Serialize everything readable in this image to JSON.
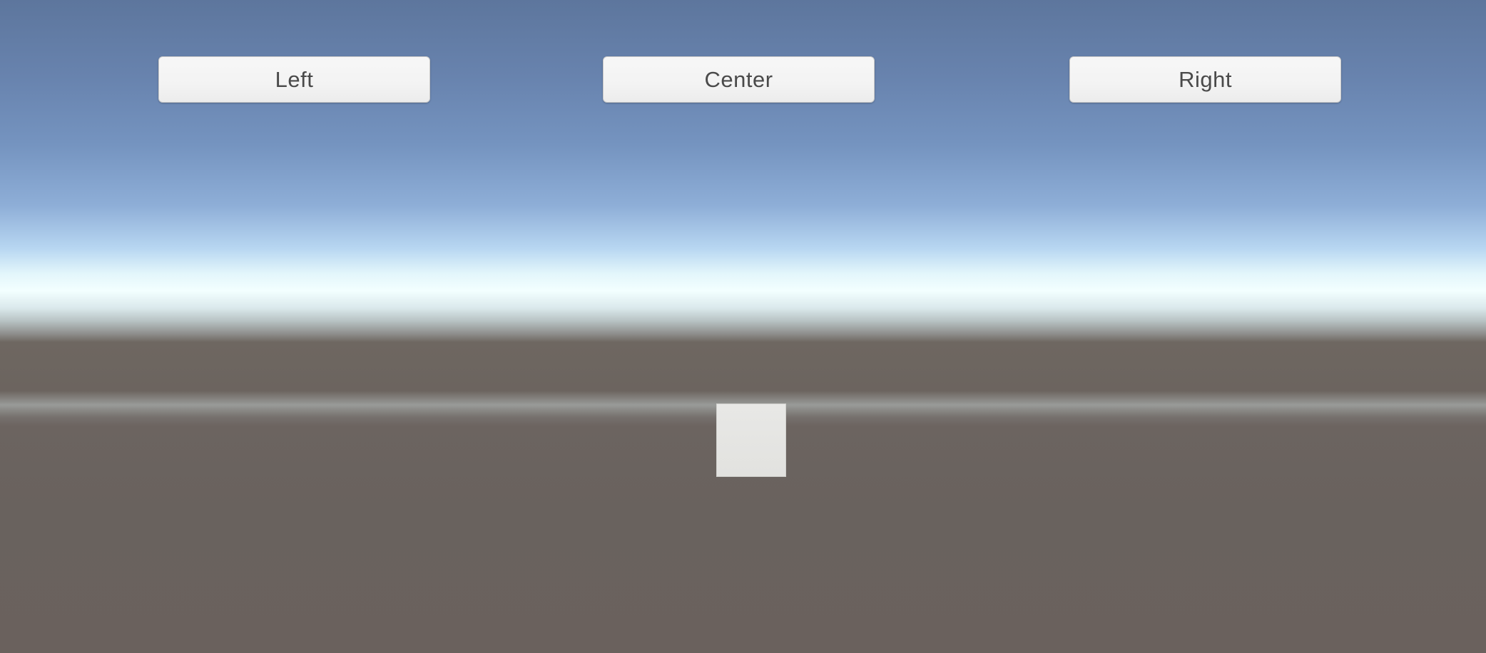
{
  "buttons": {
    "left": {
      "label": "Left"
    },
    "center": {
      "label": "Center"
    },
    "right": {
      "label": "Right"
    }
  },
  "scene": {
    "sky_color": "#6883ae",
    "horizon_color": "#f3ffff",
    "ground_color": "#6a625d",
    "cube_color": "#e4e4e1"
  }
}
